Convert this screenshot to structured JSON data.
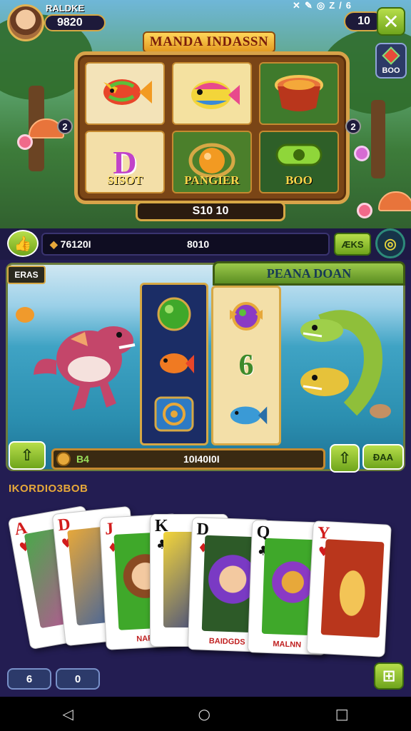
{
  "status_bar": {
    "icons": [
      "✕",
      "✎",
      "◎",
      "Z",
      "/",
      "6"
    ]
  },
  "player": {
    "name": "RALDKE",
    "coins": "9820"
  },
  "header": {
    "right_value": "10",
    "close_label": "X",
    "side_badge": "BOO"
  },
  "slot_machine": {
    "title": "MANDA INDASSN",
    "nav_left": "2",
    "nav_right": "2",
    "labels": [
      "SISOT",
      "PANGIER",
      "BOO"
    ],
    "letter": "D",
    "win_display": "S10 10"
  },
  "balance": {
    "left": "76120I",
    "right": "8010",
    "bet_label": "ÆKS"
  },
  "scene": {
    "left_tag": "ERAS",
    "right_title": "PEANA DOAN",
    "reel_number": "6",
    "spin_label": "B4",
    "spin_value": "10I40I0I",
    "cash_label": "ÐAA"
  },
  "cards": {
    "section_label": "IKORDIO3BOB",
    "items": [
      {
        "rank": "A",
        "suit": "♥",
        "suit_color": "red",
        "caption": ""
      },
      {
        "rank": "D",
        "suit": "♥",
        "suit_color": "red",
        "caption": ""
      },
      {
        "rank": "J",
        "suit": "♦",
        "suit_color": "red",
        "caption": "NAR"
      },
      {
        "rank": "K",
        "suit": "♣",
        "suit_color": "black",
        "caption": ""
      },
      {
        "rank": "D",
        "suit": "♦",
        "suit_color": "red",
        "caption": "BAIDGDS"
      },
      {
        "rank": "Q",
        "suit": "♣",
        "suit_color": "black",
        "caption": "MALNN"
      },
      {
        "rank": "Y",
        "suit": "♥",
        "suit_color": "red",
        "caption": ""
      }
    ]
  },
  "bottom": {
    "btn1": "6",
    "btn2": "0",
    "grid": "⊞"
  },
  "system_nav": {
    "back": "◁",
    "home": "○",
    "recent": "□"
  }
}
